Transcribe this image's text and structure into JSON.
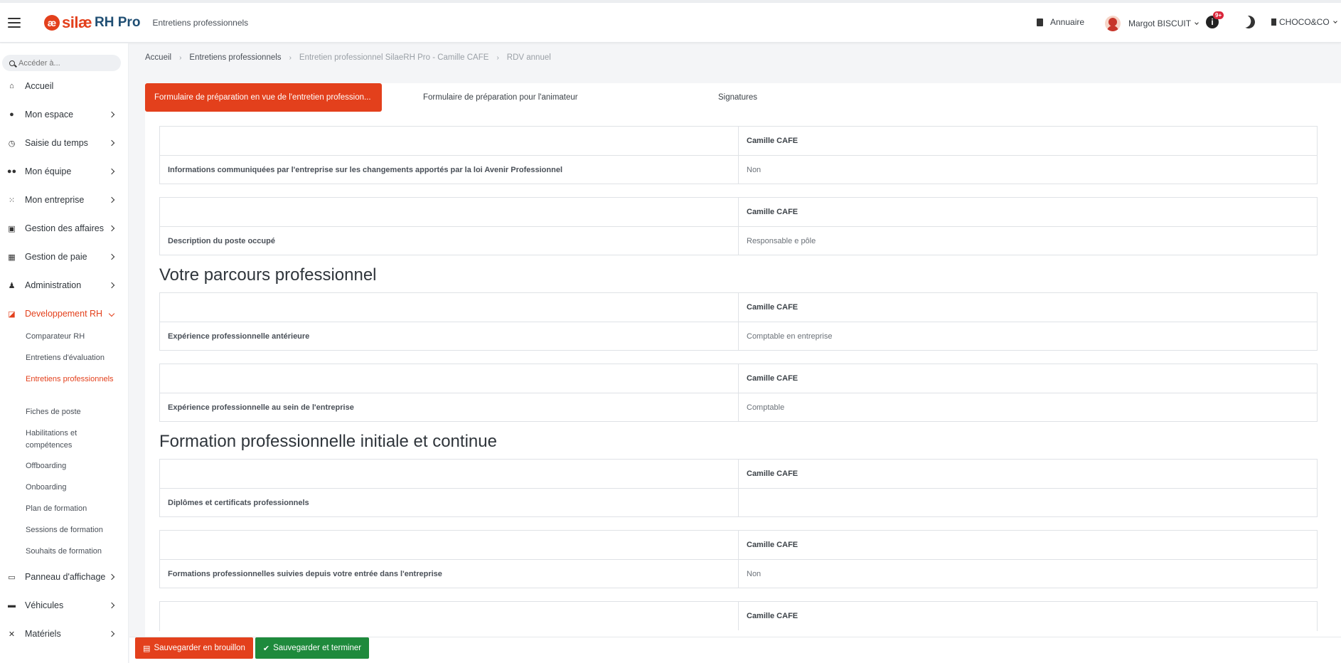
{
  "header": {
    "logo_mark": "æ",
    "logo_name": "silæ",
    "logo_suffix": "RH Pro",
    "title": "Entretiens professionnels",
    "annuaire": "Annuaire",
    "user_name": "Margot BISCUIT",
    "notif_count": "9+",
    "company": "CHOCO&CO"
  },
  "sidebar": {
    "search_placeholder": "Accéder à...",
    "items": [
      {
        "label": "Accueil",
        "icon": "home-icon"
      },
      {
        "label": "Mon espace",
        "icon": "user-icon"
      },
      {
        "label": "Saisie du temps",
        "icon": "clock-icon"
      },
      {
        "label": "Mon équipe",
        "icon": "team-icon"
      },
      {
        "label": "Mon entreprise",
        "icon": "grid-icon"
      },
      {
        "label": "Gestion des affaires",
        "icon": "clipboard-icon"
      },
      {
        "label": "Gestion de paie",
        "icon": "calculator-icon"
      },
      {
        "label": "Administration",
        "icon": "admin-icon"
      },
      {
        "label": "Developpement RH",
        "icon": "growth-icon"
      }
    ],
    "subitems": [
      "Comparateur RH",
      "Entretiens d'évaluation",
      "Entretiens professionnels",
      "Fiches de poste",
      "Habilitations et compétences",
      "Offboarding",
      "Onboarding",
      "Plan de formation",
      "Sessions de formation",
      "Souhaits de formation"
    ],
    "bottom_items": [
      {
        "label": "Panneau d'affichage",
        "icon": "board-icon"
      },
      {
        "label": "Véhicules",
        "icon": "car-icon"
      },
      {
        "label": "Matériels",
        "icon": "tools-icon"
      }
    ]
  },
  "breadcrumb": [
    "Accueil",
    "Entretiens professionnels",
    "Entretien professionnel SilaeRH Pro - Camille CAFE",
    "RDV annuel"
  ],
  "tabs": [
    "Formulaire de préparation en vue de l'entretien profession...",
    "Formulaire de préparation pour l'animateur",
    "Signatures"
  ],
  "person": "Camille CAFE",
  "blocks": [
    {
      "question": "Informations communiquées par l'entreprise sur les changements apportés par la loi Avenir Professionnel",
      "answer": "Non"
    },
    {
      "question": "Description du poste occupé",
      "answer": "Responsable e pôle"
    },
    {
      "question": "Expérience professionnelle antérieure",
      "answer": "Comptable en entreprise"
    },
    {
      "question": "Expérience professionnelle au sein de l'entreprise",
      "answer": "Comptable"
    },
    {
      "question": "Diplômes et certificats professionnels",
      "answer": ""
    },
    {
      "question": "Formations professionnelles suivies depuis votre entrée dans l'entreprise",
      "answer": "Non"
    }
  ],
  "sections": [
    "Votre parcours professionnel",
    "Formation professionnelle initiale et continue"
  ],
  "actions": {
    "draft": "Sauvegarder en brouillon",
    "finish": "Sauvegarder et terminer"
  },
  "colors": {
    "accent": "#e3401c",
    "success": "#1e8a3c",
    "brand_blue": "#1f4e73"
  }
}
